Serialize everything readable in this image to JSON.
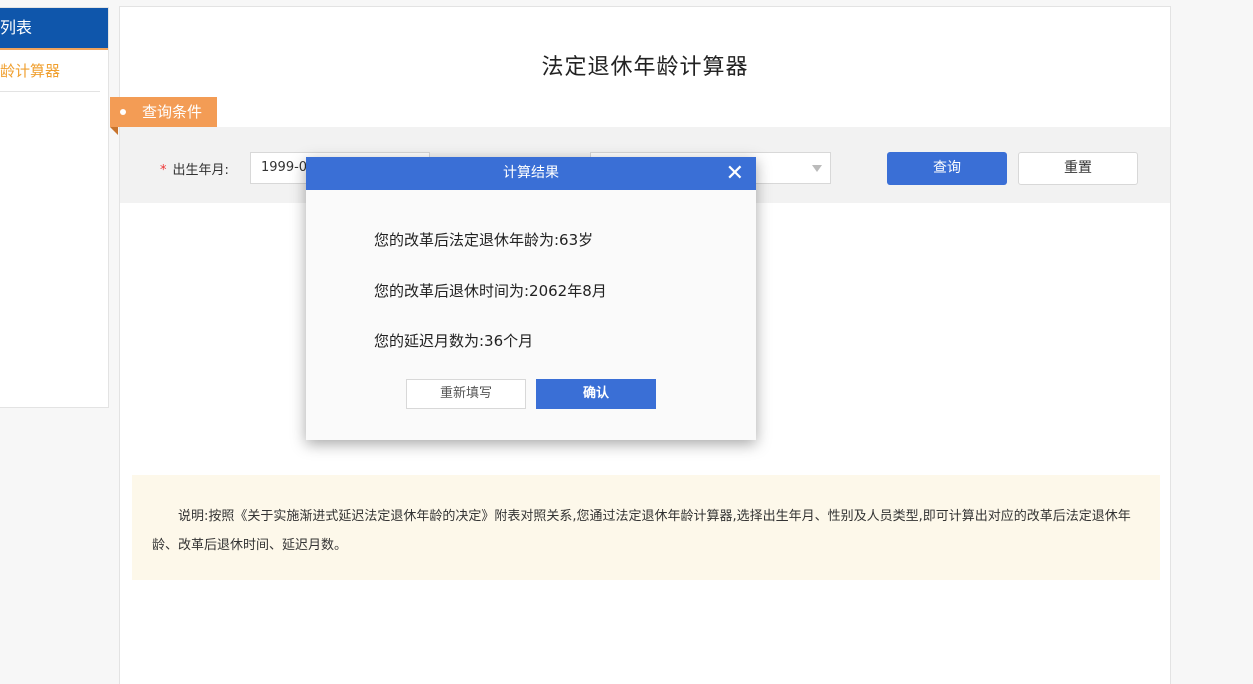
{
  "sidebar": {
    "header": "列表",
    "items": [
      {
        "label": "龄计算器"
      }
    ]
  },
  "main": {
    "title": "法定退休年龄计算器",
    "query_tag": "查询条件",
    "form": {
      "birth_label": "出生年月:",
      "birth_value": "1999-08",
      "query_button": "查询",
      "reset_button": "重置"
    },
    "note": "说明:按照《关于实施渐进式延迟法定退休年龄的决定》附表对照关系,您通过法定退休年龄计算器,选择出生年月、性别及人员类型,即可计算出对应的改革后法定退休年龄、改革后退休时间、延迟月数。"
  },
  "modal": {
    "title": "计算结果",
    "close_symbol": "✕",
    "lines": [
      "您的改革后法定退休年龄为:63岁",
      "您的改革后退休时间为:2062年8月",
      "您的延迟月数为:36个月"
    ],
    "refill_button": "重新填写",
    "confirm_button": "确认"
  },
  "colors": {
    "primary": "#3a6fd6",
    "sidebar_header": "#0f56ab",
    "accent_orange": "#f39c55",
    "note_bg": "#fdf8ea"
  }
}
